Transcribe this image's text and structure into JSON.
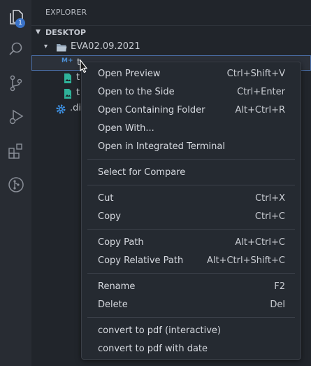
{
  "activity_bar": {
    "explorer_badge": "1",
    "icons": [
      "files-icon",
      "search-icon",
      "source-control-icon",
      "run-debug-icon",
      "extensions-icon",
      "git-graph-icon"
    ]
  },
  "sidebar": {
    "title": "EXPLORER",
    "section": "DESKTOP",
    "folder": "EVA02.09.2021",
    "files": [
      {
        "name": "t",
        "icon": "markdown-icon",
        "badge_text": "M+",
        "selected": true
      },
      {
        "name": "t",
        "icon": "image-icon",
        "selected": false
      },
      {
        "name": "t",
        "icon": "image-icon",
        "selected": false
      },
      {
        "name": ".di",
        "icon": "gear-icon",
        "selected": false
      }
    ]
  },
  "context_menu": {
    "groups": [
      [
        {
          "label": "Open Preview",
          "shortcut": "Ctrl+Shift+V"
        },
        {
          "label": "Open to the Side",
          "shortcut": "Ctrl+Enter"
        },
        {
          "label": "Open Containing Folder",
          "shortcut": "Alt+Ctrl+R"
        },
        {
          "label": "Open With...",
          "shortcut": ""
        },
        {
          "label": "Open in Integrated Terminal",
          "shortcut": ""
        }
      ],
      [
        {
          "label": "Select for Compare",
          "shortcut": ""
        }
      ],
      [
        {
          "label": "Cut",
          "shortcut": "Ctrl+X"
        },
        {
          "label": "Copy",
          "shortcut": "Ctrl+C"
        }
      ],
      [
        {
          "label": "Copy Path",
          "shortcut": "Alt+Ctrl+C"
        },
        {
          "label": "Copy Relative Path",
          "shortcut": "Alt+Ctrl+Shift+C"
        }
      ],
      [
        {
          "label": "Rename",
          "shortcut": "F2"
        },
        {
          "label": "Delete",
          "shortcut": "Del"
        }
      ],
      [
        {
          "label": "convert to pdf (interactive)",
          "shortcut": ""
        },
        {
          "label": "convert to pdf with date",
          "shortcut": ""
        }
      ]
    ]
  },
  "colors": {
    "activity_bg": "#282c33",
    "sidebar_bg": "#21252b",
    "menu_bg": "#252a31",
    "badge": "#3a73c9",
    "markdown_icon": "#4d8fd6",
    "image_icon": "#2fb39a",
    "gear_icon": "#3d8fe0"
  }
}
